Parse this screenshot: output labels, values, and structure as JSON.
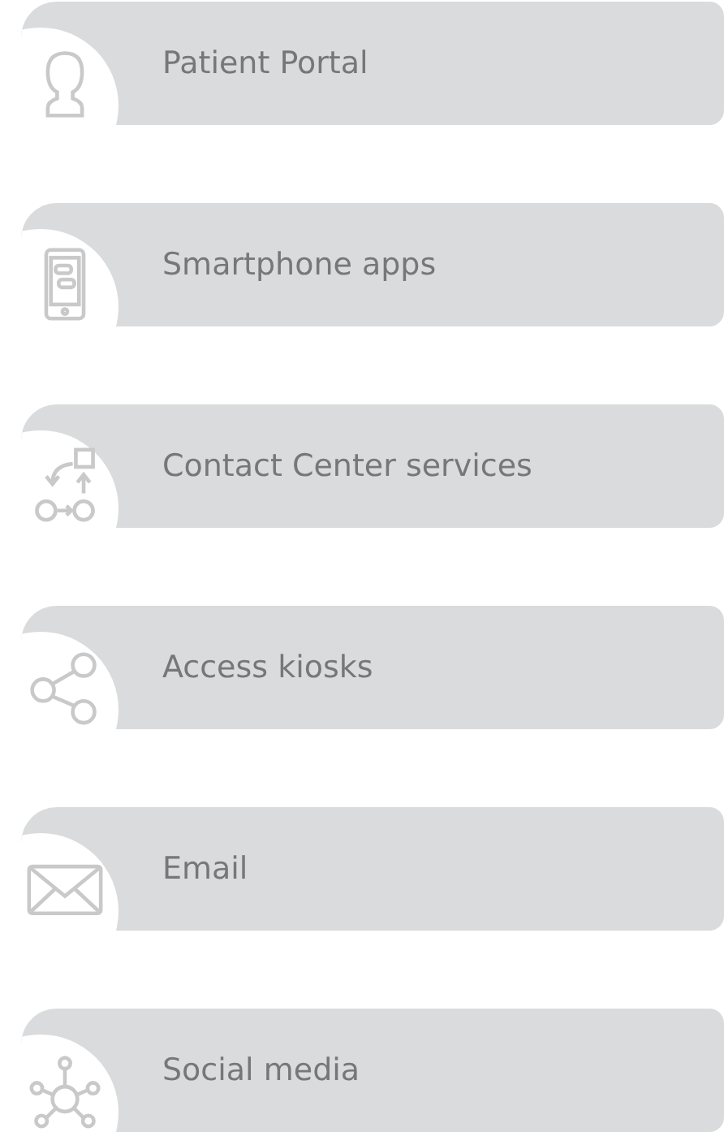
{
  "items": [
    {
      "label": "Patient Portal"
    },
    {
      "label": "Smartphone apps"
    },
    {
      "label": "Contact Center services"
    },
    {
      "label": "Access kiosks"
    },
    {
      "label": "Email"
    },
    {
      "label": "Social media"
    }
  ]
}
